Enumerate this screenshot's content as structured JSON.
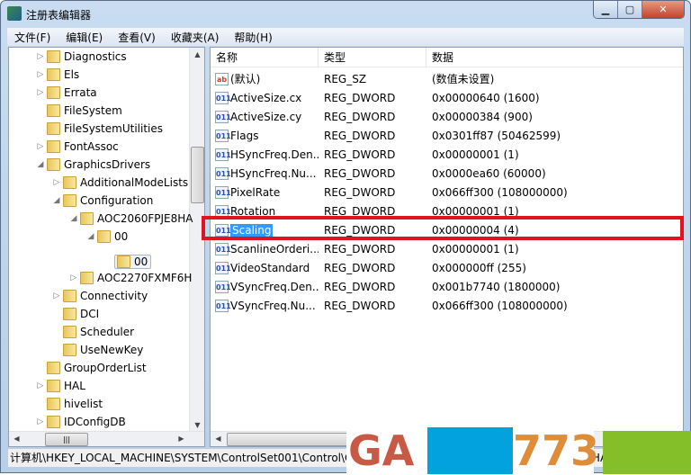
{
  "window": {
    "title": "注册表编辑器",
    "min": "▭",
    "max": "□",
    "close": "✕"
  },
  "menu": [
    "文件(F)",
    "编辑(E)",
    "查看(V)",
    "收藏夹(A)",
    "帮助(H)"
  ],
  "tree": [
    {
      "label": "Diagnostics",
      "level": 0,
      "state": "collapsed"
    },
    {
      "label": "Els",
      "level": 0,
      "state": "collapsed"
    },
    {
      "label": "Errata",
      "level": 0,
      "state": "collapsed"
    },
    {
      "label": "FileSystem",
      "level": 0,
      "state": "leaf"
    },
    {
      "label": "FileSystemUtilities",
      "level": 0,
      "state": "leaf"
    },
    {
      "label": "FontAssoc",
      "level": 0,
      "state": "collapsed"
    },
    {
      "label": "GraphicsDrivers",
      "level": 0,
      "state": "expanded"
    },
    {
      "label": "AdditionalModeLists",
      "level": 1,
      "state": "collapsed"
    },
    {
      "label": "Configuration",
      "level": 1,
      "state": "expanded"
    },
    {
      "label": "AOC2060FPJE8HA",
      "level": 2,
      "state": "expanded"
    },
    {
      "label": "00",
      "level": 3,
      "state": "expanded"
    },
    {
      "label": "00",
      "level": 4,
      "state": "leaf",
      "selected": true
    },
    {
      "label": "AOC2270FXMF6H",
      "level": 2,
      "state": "collapsed"
    },
    {
      "label": "Connectivity",
      "level": 1,
      "state": "collapsed"
    },
    {
      "label": "DCI",
      "level": 1,
      "state": "leaf"
    },
    {
      "label": "Scheduler",
      "level": 1,
      "state": "leaf"
    },
    {
      "label": "UseNewKey",
      "level": 1,
      "state": "leaf"
    },
    {
      "label": "GroupOrderList",
      "level": 0,
      "state": "leaf"
    },
    {
      "label": "HAL",
      "level": 0,
      "state": "collapsed"
    },
    {
      "label": "hivelist",
      "level": 0,
      "state": "leaf"
    },
    {
      "label": "IDConfigDB",
      "level": 0,
      "state": "collapsed"
    }
  ],
  "list": {
    "headers": [
      "名称",
      "类型",
      "数据"
    ],
    "rows": [
      {
        "icon": "string-value-icon",
        "name": "(默认)",
        "type": "REG_SZ",
        "data": "(数值未设置)"
      },
      {
        "icon": "binary-value-icon",
        "name": "ActiveSize.cx",
        "type": "REG_DWORD",
        "data": "0x00000640 (1600)"
      },
      {
        "icon": "binary-value-icon",
        "name": "ActiveSize.cy",
        "type": "REG_DWORD",
        "data": "0x00000384 (900)"
      },
      {
        "icon": "binary-value-icon",
        "name": "Flags",
        "type": "REG_DWORD",
        "data": "0x0301ff87 (50462599)"
      },
      {
        "icon": "binary-value-icon",
        "name": "HSyncFreq.Den...",
        "type": "REG_DWORD",
        "data": "0x00000001 (1)"
      },
      {
        "icon": "binary-value-icon",
        "name": "HSyncFreq.Nu...",
        "type": "REG_DWORD",
        "data": "0x0000ea60 (60000)"
      },
      {
        "icon": "binary-value-icon",
        "name": "PixelRate",
        "type": "REG_DWORD",
        "data": "0x066ff300 (108000000)"
      },
      {
        "icon": "binary-value-icon",
        "name": "Rotation",
        "type": "REG_DWORD",
        "data": "0x00000001 (1)"
      },
      {
        "icon": "binary-value-icon",
        "name": "Scaling",
        "type": "REG_DWORD",
        "data": "0x00000004 (4)",
        "selected": true
      },
      {
        "icon": "binary-value-icon",
        "name": "ScanlineOrderi...",
        "type": "REG_DWORD",
        "data": "0x00000001 (1)"
      },
      {
        "icon": "binary-value-icon",
        "name": "VideoStandard",
        "type": "REG_DWORD",
        "data": "0x000000ff (255)"
      },
      {
        "icon": "binary-value-icon",
        "name": "VSyncFreq.Den...",
        "type": "REG_DWORD",
        "data": "0x001b7740 (1800000)"
      },
      {
        "icon": "binary-value-icon",
        "name": "VSyncFreq.Nu...",
        "type": "REG_DWORD",
        "data": "0x066ff300 (108000000)"
      }
    ]
  },
  "status": "计算机\\HKEY_LOCAL_MACHINE\\SYSTEM\\ControlSet001\\Control\\GraphicsDrivers\\Configuration\\AOC2060FPJE8HA\\00\\00",
  "watermark": {
    "text_left": "GA",
    "text_right": "773",
    "colors": [
      "#c85a45",
      "#02a2df",
      "#de8c38",
      "#84bf2a"
    ]
  },
  "highlight_color": "#e0141f"
}
